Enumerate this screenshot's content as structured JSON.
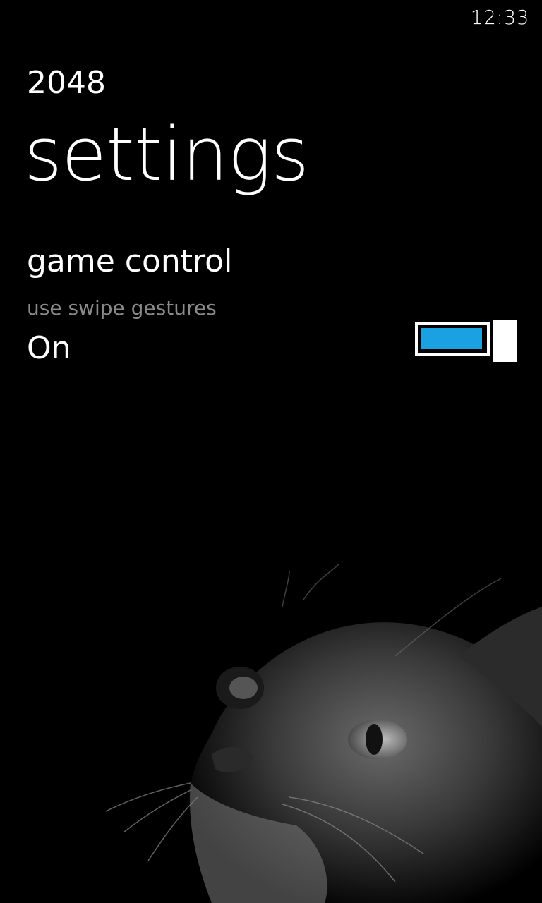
{
  "status_bar": {
    "time": "12:33"
  },
  "app": {
    "title": "2048"
  },
  "page": {
    "title": "settings"
  },
  "game_control": {
    "heading": "game control",
    "toggle_label": "use swipe gestures",
    "toggle_state": "On",
    "toggle_on": true
  },
  "colors": {
    "accent": "#1ba1e2",
    "background": "#000000",
    "secondary_text": "#8a8a8a"
  },
  "icons": {
    "background_image": "cat-photo"
  }
}
